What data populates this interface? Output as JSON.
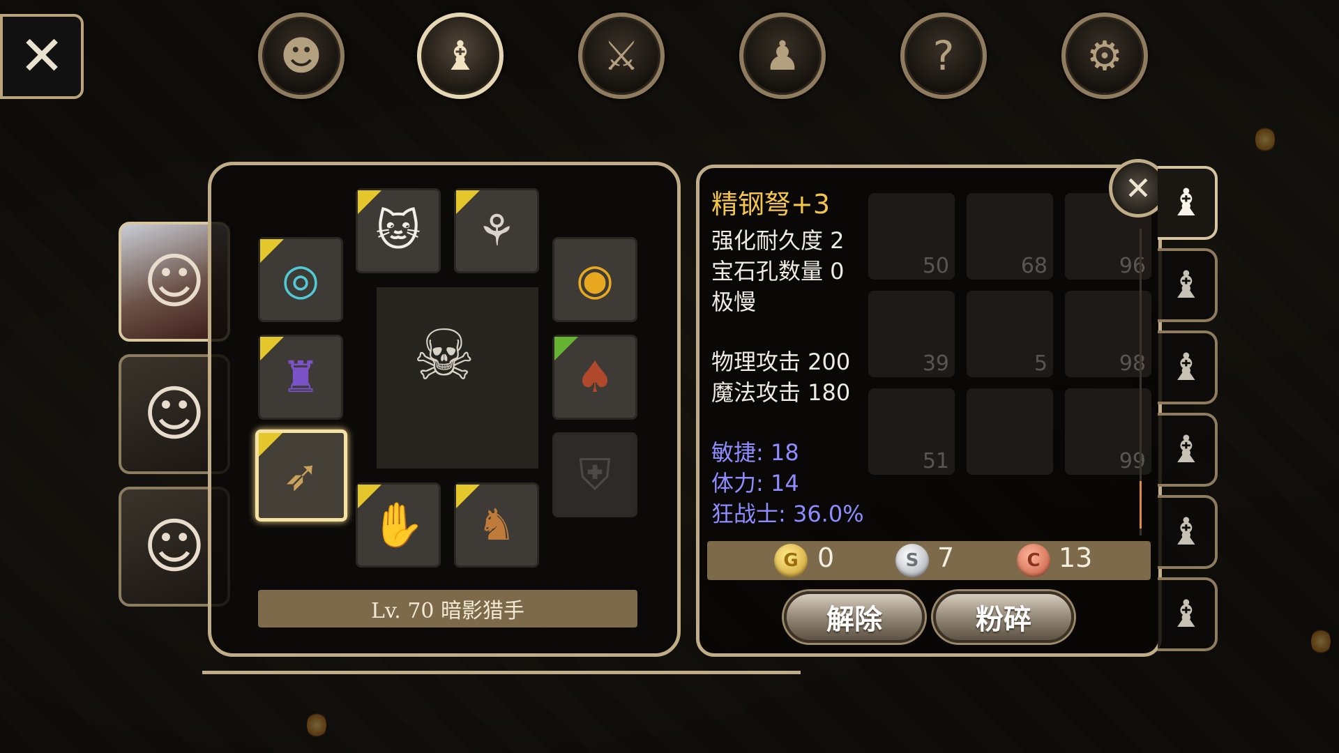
{
  "top_menu": {
    "close_icon": "close-icon",
    "buttons": [
      {
        "name": "head-icon",
        "glyph": "☺"
      },
      {
        "name": "bag-icon",
        "glyph": "👝"
      },
      {
        "name": "sword-compass-icon",
        "glyph": "⚔"
      },
      {
        "name": "party-icon",
        "glyph": "👥"
      },
      {
        "name": "quest-scroll-icon",
        "glyph": "📜"
      },
      {
        "name": "gear-icon",
        "glyph": "⚙"
      }
    ],
    "active_index": 1
  },
  "portraits": [
    {
      "name": "portrait-white-hair",
      "glyph": "☺"
    },
    {
      "name": "portrait-red-hair",
      "glyph": "☺"
    },
    {
      "name": "portrait-brown-hair",
      "glyph": "☺"
    }
  ],
  "equipment": {
    "slots": {
      "helmet": {
        "icon": "cat-mask-icon",
        "glyph": "🐱"
      },
      "necklace": {
        "icon": "claw-necklace-icon",
        "glyph": "⚘"
      },
      "ring_left": {
        "icon": "silver-ring-icon",
        "glyph": "◎"
      },
      "ring_right": {
        "icon": "gold-ring-icon",
        "glyph": "💍"
      },
      "armor": {
        "icon": "purple-armor-icon",
        "glyph": "🛡"
      },
      "cloak": {
        "icon": "red-cloak-icon",
        "glyph": "🧥"
      },
      "weapon": {
        "icon": "crossbow-icon",
        "glyph": "🏹"
      },
      "offhand": {
        "icon": "empty-shield-icon",
        "glyph": "⛨"
      },
      "gloves": {
        "icon": "gauntlet-icon",
        "glyph": "🧤"
      },
      "boots": {
        "icon": "boot-icon",
        "glyph": "👢"
      }
    },
    "level_label": "Lv. 70 暗影猎手"
  },
  "item_detail": {
    "title": "精钢弩+3",
    "stats": [
      "强化耐久度 2",
      "宝石孔数量 0",
      "极慢",
      "物理攻击 200",
      "魔法攻击 180"
    ],
    "bonus_stats": [
      "敏捷: 18",
      "体力: 14",
      "狂战士: 36.0%"
    ],
    "currency": {
      "gold": "0",
      "silver": "7",
      "copper": "13",
      "gold_letter": "G",
      "silver_letter": "S",
      "copper_letter": "C"
    },
    "buttons": {
      "unequip": "解除",
      "smash": "粉碎"
    },
    "background_counts": [
      "50",
      "68",
      "96",
      "39",
      "5",
      "98",
      "51",
      "99"
    ]
  },
  "bag_tabs": [
    "bag-tab-1",
    "bag-tab-2",
    "bag-tab-3",
    "bag-tab-4",
    "bag-tab-5",
    "bag-tab-quest"
  ],
  "colors": {
    "title_gold": "#f3c54a",
    "bonus_blue": "#8f8cff",
    "frame": "#c0ad88"
  }
}
